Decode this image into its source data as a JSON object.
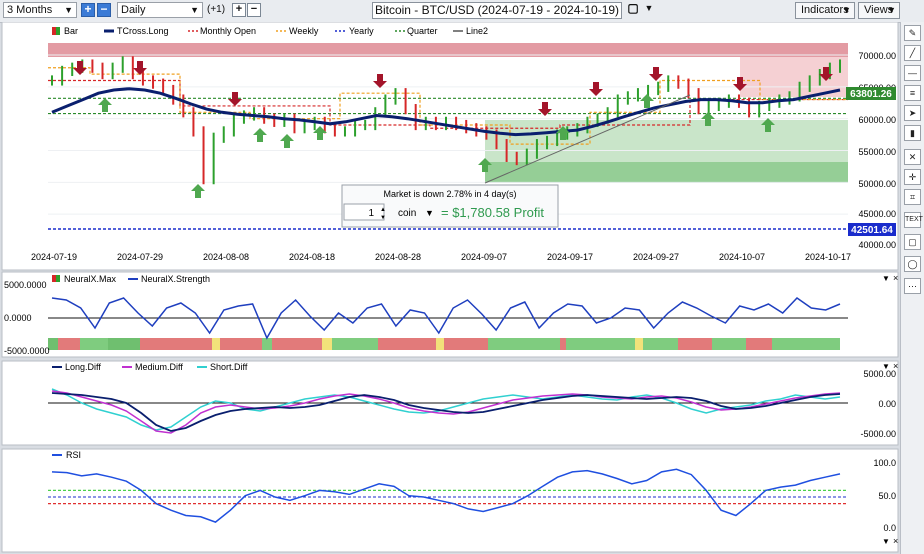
{
  "toolbar": {
    "period": "3 Months",
    "interval": "Daily",
    "offset": "(+1)",
    "title": "Bitcoin - BTC/USD (2024-07-19 - 2024-10-19)",
    "indicators_label": "Indicators",
    "views_label": "Views"
  },
  "main_legend": [
    {
      "label": "Bar",
      "color": "#2ca02c",
      "style": "bar"
    },
    {
      "label": "TCross.Long",
      "color": "#0a1f6e",
      "style": "line"
    },
    {
      "label": "Monthly Open",
      "color": "#d62728",
      "style": "dash"
    },
    {
      "label": "Weekly",
      "color": "#f0a020",
      "style": "dash"
    },
    {
      "label": "Yearly",
      "color": "#1a2ccc",
      "style": "dash"
    },
    {
      "label": "Quarter",
      "color": "#2a8a2a",
      "style": "dash"
    },
    {
      "label": "Line2",
      "color": "#555555",
      "style": "line"
    }
  ],
  "price_axis": [
    "70000.00",
    "65000.00",
    "60000.00",
    "55000.00",
    "50000.00",
    "45000.00",
    "40000.00"
  ],
  "price_badges": {
    "current": "63801.26",
    "yearly": "42501.64"
  },
  "date_axis": [
    "2024-07-19",
    "2024-07-29",
    "2024-08-08",
    "2024-08-18",
    "2024-08-28",
    "2024-09-07",
    "2024-09-17",
    "2024-09-27",
    "2024-10-07",
    "2024-10-17"
  ],
  "info_box": {
    "message": "Market is down 2.78% in 4 day(s)",
    "quantity": "1",
    "unit": "coin",
    "result": "= $1,780.58 Profit"
  },
  "neural_panel": {
    "legend": [
      {
        "label": "NeuralX.Max",
        "color": "#d62728"
      },
      {
        "label": "NeuralX.Strength",
        "color": "#1f3fbf"
      }
    ],
    "axis": [
      "5000.0000",
      "0.0000",
      "-5000.0000"
    ]
  },
  "diff_panel": {
    "legend": [
      {
        "label": "Long.Diff",
        "color": "#0a1f6e"
      },
      {
        "label": "Medium.Diff",
        "color": "#c030d0"
      },
      {
        "label": "Short.Diff",
        "color": "#30d0d0"
      }
    ],
    "axis": [
      "5000.00",
      "0.00",
      "-5000.00"
    ]
  },
  "rsi_panel": {
    "legend": [
      {
        "label": "RSI",
        "color": "#1f4fe0"
      }
    ],
    "axis": [
      "100.0",
      "50.0",
      "0.0"
    ]
  },
  "sidebar_icons": [
    "pencil-icon",
    "line-icon",
    "horizontal-line-icon",
    "fib-icon",
    "arrow-icon",
    "bar-icon",
    "cross-icon",
    "crosshair-icon",
    "measure-icon",
    "text-icon",
    "rectangle-icon",
    "circle-icon",
    "more-icon"
  ],
  "chart_data": {
    "type": "bar",
    "price_series": [
      66,
      67.5,
      68,
      68.5,
      68,
      67,
      68,
      69,
      67,
      66,
      65.5,
      64.5,
      63,
      61,
      58,
      50.5,
      57,
      58,
      60,
      60.5,
      61,
      60,
      59.5,
      60,
      58.5,
      59,
      59.5,
      58.5,
      58,
      58,
      59,
      59,
      61,
      63,
      64,
      61.5,
      59,
      59.5,
      59,
      59.5,
      59,
      58.5,
      58,
      57.5,
      56,
      54,
      53.5,
      54.5,
      56,
      56.5,
      57.5,
      58,
      58.5,
      59.5,
      60,
      61,
      63,
      63.5,
      64,
      64.5,
      65,
      66,
      65.5,
      64,
      61.5,
      62,
      62.5,
      63,
      62.5,
      61,
      62,
      62.5,
      63,
      63.5,
      65,
      66,
      67,
      68,
      68.5
    ],
    "tcross_long": [
      61,
      62,
      63,
      64,
      64.5,
      64.7,
      64.5,
      64,
      63.2,
      62.3,
      61.5,
      61,
      60.7,
      60.5,
      60.3,
      60,
      59.8,
      59.5,
      59.2,
      59.5,
      60,
      60.5,
      60.3,
      60,
      59.6,
      59.2,
      58.8,
      58.4,
      58,
      57.7,
      57.5,
      57.6,
      57.8,
      58,
      58.2,
      58.8,
      59.5,
      60.3,
      61,
      61.7,
      62.2,
      62.7,
      63,
      63,
      62.8,
      62.5,
      62.5,
      62.8,
      63,
      63.5,
      64,
      64.5
    ],
    "rsi": [
      88,
      87,
      82,
      85,
      80,
      74,
      60,
      40,
      30,
      22,
      20,
      12,
      30,
      52,
      60,
      50,
      45,
      52,
      60,
      58,
      54,
      62,
      70,
      66,
      52,
      50,
      45,
      40,
      32,
      28,
      34,
      40,
      52,
      66,
      80,
      88,
      90,
      85,
      78,
      70,
      75,
      88,
      92,
      84,
      60,
      30,
      22,
      40,
      60,
      65,
      68,
      75,
      80,
      85
    ],
    "rsi_levels": {
      "overbought": 60,
      "oversold": 40,
      "middle": 50
    }
  }
}
